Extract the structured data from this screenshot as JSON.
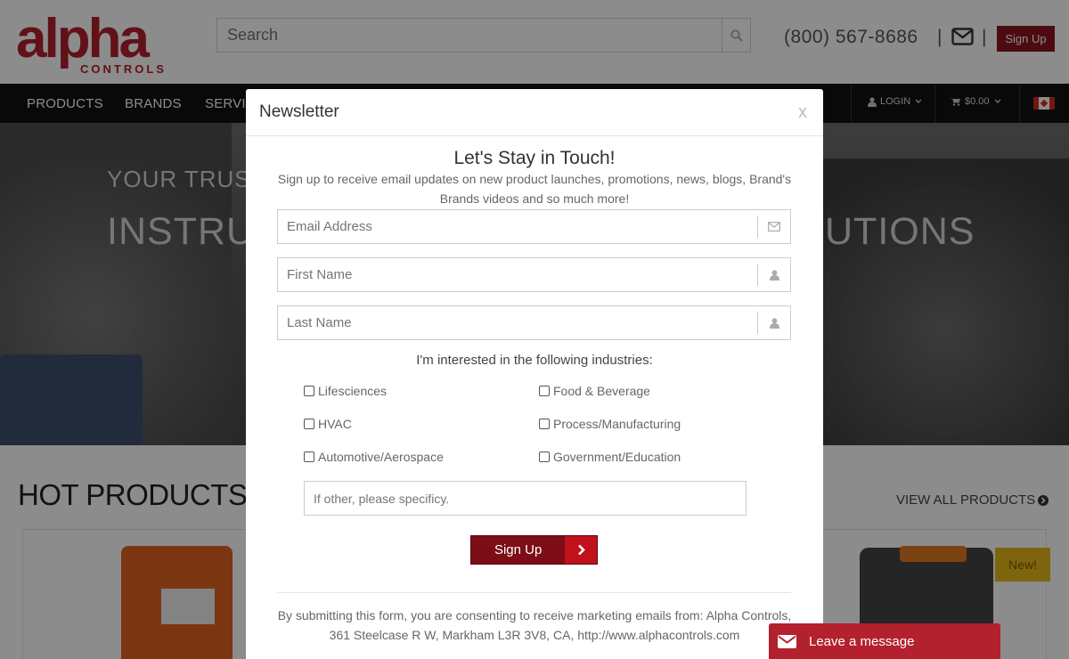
{
  "header": {
    "logo_text": "alpha",
    "logo_sub": "CONTROLS",
    "search_placeholder": "Search",
    "phone": "(800) 567-8686",
    "separator": "|",
    "signup_label": "Sign Up"
  },
  "nav": {
    "items": [
      "PRODUCTS",
      "BRANDS",
      "SERVIC"
    ],
    "login": "LOGIN",
    "cart": "$0.00"
  },
  "hero": {
    "line1": "YOUR TRUS",
    "line2_left": "INSTRU",
    "line2_right": "UTIONS"
  },
  "hot_products": {
    "title": "HOT PRODUCTS",
    "view_all": "VIEW ALL PRODUCTS",
    "new_tag": "New!"
  },
  "modal": {
    "title": "Newsletter",
    "close": "x",
    "heading": "Let's Stay in Touch!",
    "lead": "Sign up to receive email updates on new product launches, promotions, news, blogs, Brand's Brands videos and so much more!",
    "email_placeholder": "Email Address",
    "first_name_placeholder": "First Name",
    "last_name_placeholder": "Last Name",
    "industries_label": "I'm interested in the following industries:",
    "industries": [
      {
        "label": "Lifesciences",
        "checked": false
      },
      {
        "label": "Food & Beverage",
        "checked": false
      },
      {
        "label": "HVAC",
        "checked": false
      },
      {
        "label": "Process/Manufacturing",
        "checked": false
      },
      {
        "label": "Automotive/Aerospace",
        "checked": false
      },
      {
        "label": "Government/Education",
        "checked": false
      }
    ],
    "other_placeholder": "If other, please specificy.",
    "submit_label": "Sign Up",
    "consent": "By submitting this form, you are consenting to receive marketing emails from: Alpha Controls, 361 Steelcase R W, Markham L3R 3V8, CA, http://www.alphacontrols.com"
  },
  "chat": {
    "label": "Leave a message"
  },
  "colors": {
    "brand_red": "#b3202e",
    "dark_red": "#7d0d16",
    "nav_bg": "#111111"
  }
}
